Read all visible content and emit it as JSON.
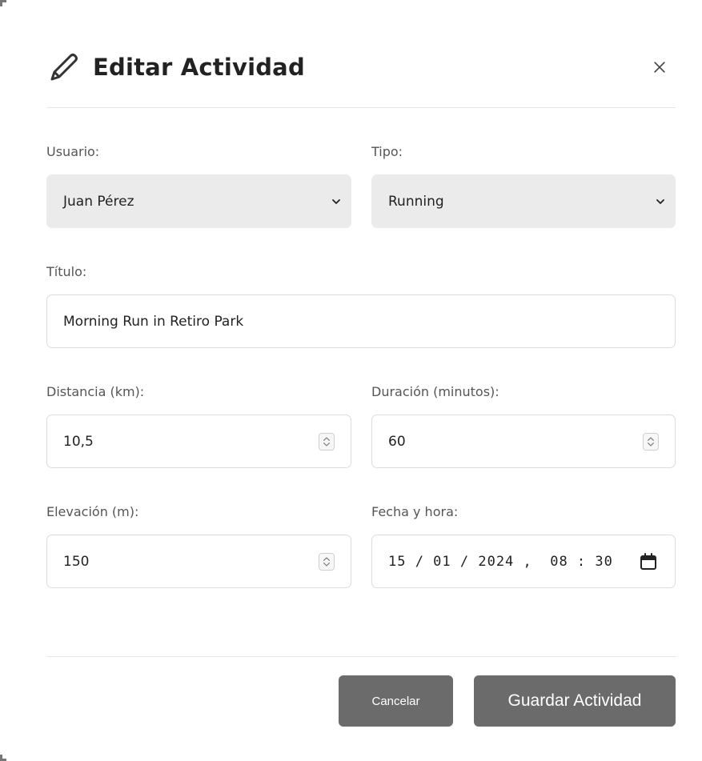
{
  "modal": {
    "title": "Editar Actividad",
    "icons": {
      "title": "pencil-icon",
      "close": "close-icon"
    }
  },
  "form": {
    "usuario": {
      "label": "Usuario:",
      "value": "Juan Pérez"
    },
    "tipo": {
      "label": "Tipo:",
      "value": "Running"
    },
    "titulo": {
      "label": "Título:",
      "value": "Morning Run in Retiro Park"
    },
    "distancia": {
      "label": "Distancia (km):",
      "value": "10,5"
    },
    "duracion": {
      "label": "Duración (minutos):",
      "value": "60"
    },
    "elevacion": {
      "label": "Elevación (m):",
      "value": "150"
    },
    "fecha": {
      "label": "Fecha y hora:",
      "value": "15 / 01 / 2024 ,  08 : 30"
    }
  },
  "footer": {
    "cancel_label": "Cancelar",
    "save_label": "Guardar Actividad"
  },
  "colors": {
    "button_bg": "#6b6b6b",
    "select_bg": "#ebebeb",
    "input_border": "#dcdcdc"
  }
}
